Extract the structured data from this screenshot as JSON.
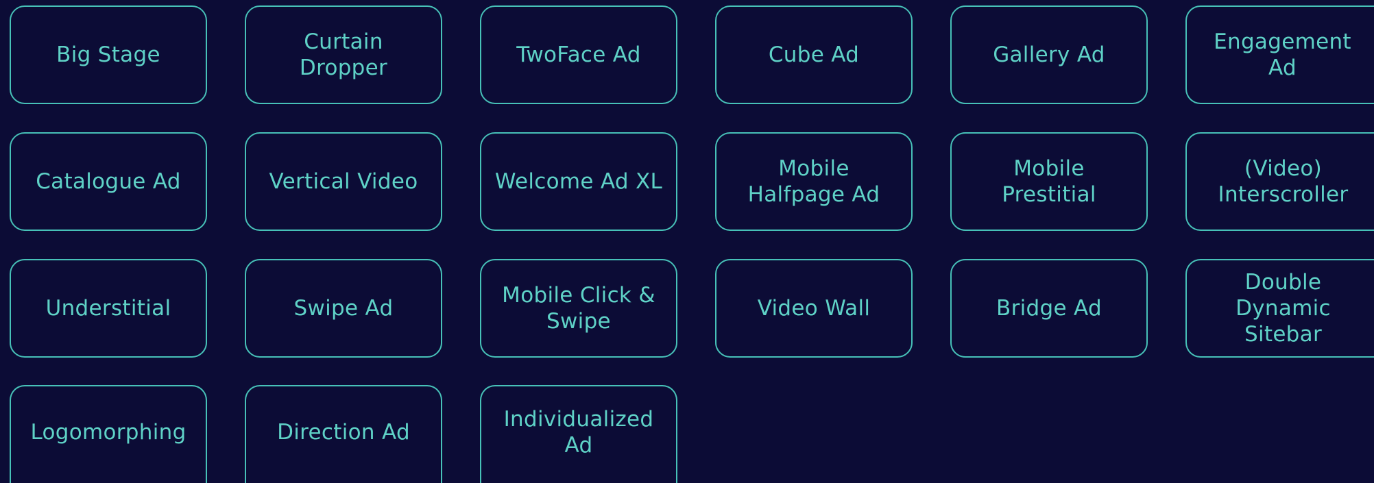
{
  "theme": {
    "background": "#0c0c36",
    "accent": "#47c1b8",
    "text": "#5fd2c7"
  },
  "tiles": [
    {
      "label": "Big Stage"
    },
    {
      "label": "Curtain\nDropper"
    },
    {
      "label": "TwoFace Ad"
    },
    {
      "label": "Cube Ad"
    },
    {
      "label": "Gallery Ad"
    },
    {
      "label": "Engagement\nAd"
    },
    {
      "label": "Catalogue Ad"
    },
    {
      "label": "Vertical Video"
    },
    {
      "label": "Welcome Ad XL"
    },
    {
      "label": "Mobile\nHalfpage Ad"
    },
    {
      "label": "Mobile\nPrestitial"
    },
    {
      "label": "(Video)\nInterscroller"
    },
    {
      "label": "Understitial"
    },
    {
      "label": "Swipe Ad"
    },
    {
      "label": "Mobile Click &\nSwipe"
    },
    {
      "label": "Video Wall"
    },
    {
      "label": "Bridge Ad"
    },
    {
      "label": "Double\nDynamic\nSitebar"
    },
    {
      "label": "Logomorphing"
    },
    {
      "label": "Direction Ad"
    },
    {
      "label": "Individualized\nAd"
    }
  ]
}
